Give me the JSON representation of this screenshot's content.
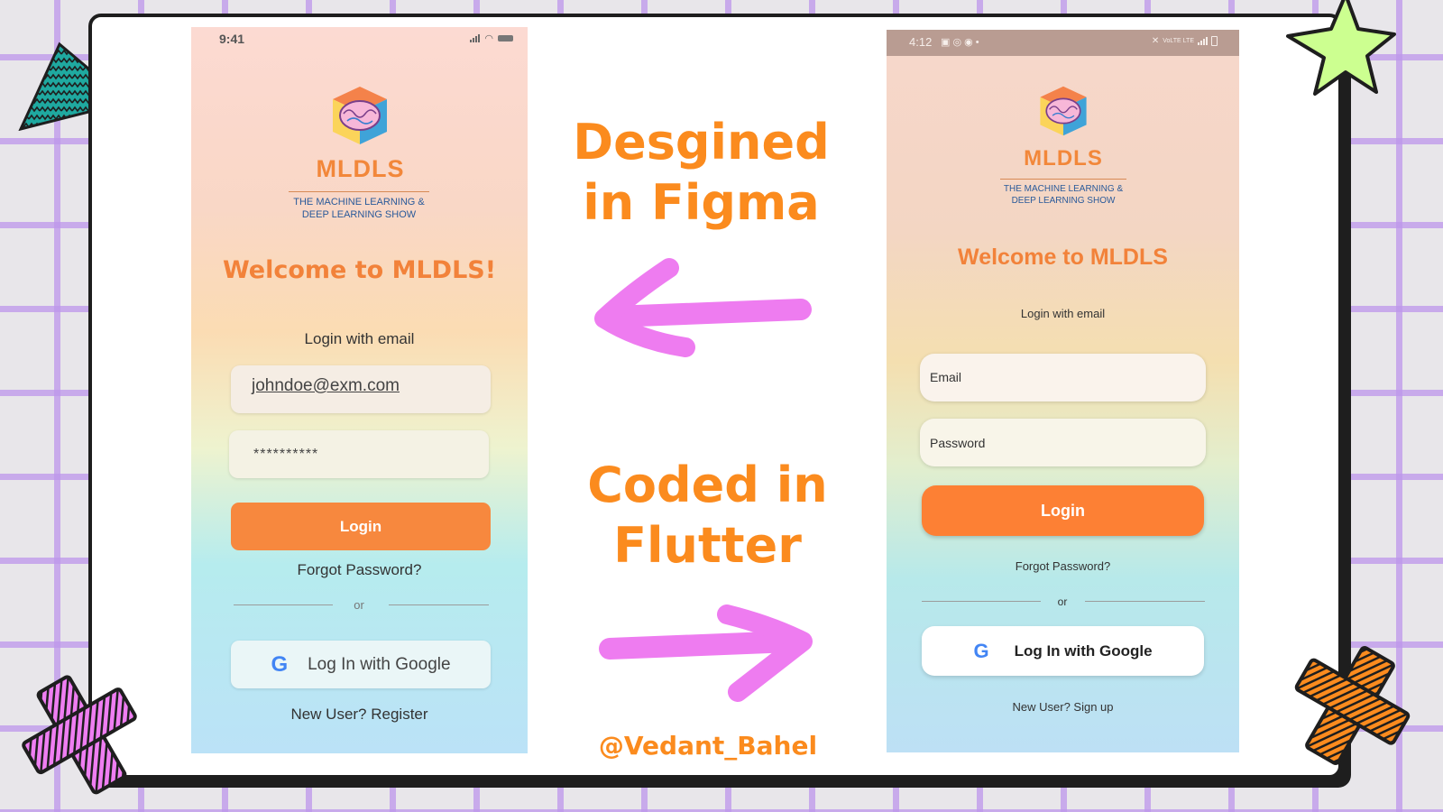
{
  "colors": {
    "accent_orange": "#fb8b1e",
    "button_orange": "#f7883e",
    "arrow_pink": "#ee7cf0",
    "grid_purple": "#be96eb",
    "star_green": "#ccff90",
    "triangle_teal": "#1fa9a0"
  },
  "center": {
    "figma_caption_line1": "Desgined",
    "figma_caption_line2": "in Figma",
    "flutter_caption_line1": "Coded in",
    "flutter_caption_line2": "Flutter",
    "handle": "@Vedant_Bahel"
  },
  "figma_phone": {
    "status_time": "9:41",
    "logo_word": "MLDLS",
    "logo_subtitle_line1": "THE MACHINE LEARNING &",
    "logo_subtitle_line2": "DEEP LEARNING SHOW",
    "welcome": "Welcome to MLDLS!",
    "login_with": "Login with email",
    "email_value": "johndoe@exm.com",
    "password_value": "**********",
    "login_button": "Login",
    "forgot_password": "Forgot Password?",
    "or": "or",
    "google_button": "Log In with Google",
    "register_link": "New User? Register"
  },
  "flutter_phone": {
    "status_time": "4:12",
    "status_right": "VoLTE LTE",
    "logo_word": "MLDLS",
    "logo_subtitle_line1": "THE MACHINE LEARNING &",
    "logo_subtitle_line2": "DEEP LEARNING SHOW",
    "welcome": "Welcome to MLDLS",
    "login_with": "Login with email",
    "email_placeholder": "Email",
    "password_placeholder": "Password",
    "login_button": "Login",
    "forgot_password": "Forgot Password?",
    "or": "or",
    "google_button": "Log In with Google",
    "signup_link": "New User? Sign up"
  }
}
